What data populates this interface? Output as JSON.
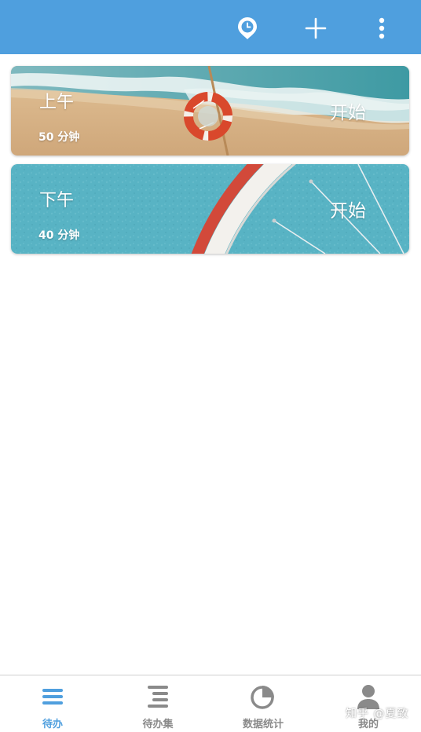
{
  "header": {
    "title": "",
    "icons": [
      "clock-pin-icon",
      "plus-icon",
      "more-vertical-icon"
    ]
  },
  "tasks": [
    {
      "title": "上午",
      "duration": "50 分钟",
      "action": "开始",
      "image": "beach-lifebuoy"
    },
    {
      "title": "下午",
      "duration": "40 分钟",
      "action": "开始",
      "image": "bicycle-wheel"
    }
  ],
  "nav": {
    "items": [
      {
        "label": "待办",
        "icon": "list-icon",
        "active": true
      },
      {
        "label": "待办集",
        "icon": "list-stack-icon",
        "active": false
      },
      {
        "label": "数据统计",
        "icon": "pie-chart-icon",
        "active": false
      },
      {
        "label": "我的",
        "icon": "user-icon",
        "active": false
      }
    ]
  },
  "watermark": "知乎 @夏致",
  "colors": {
    "primary": "#4f9fde",
    "inactive": "#8a8a8a",
    "background": "#ffffff"
  }
}
